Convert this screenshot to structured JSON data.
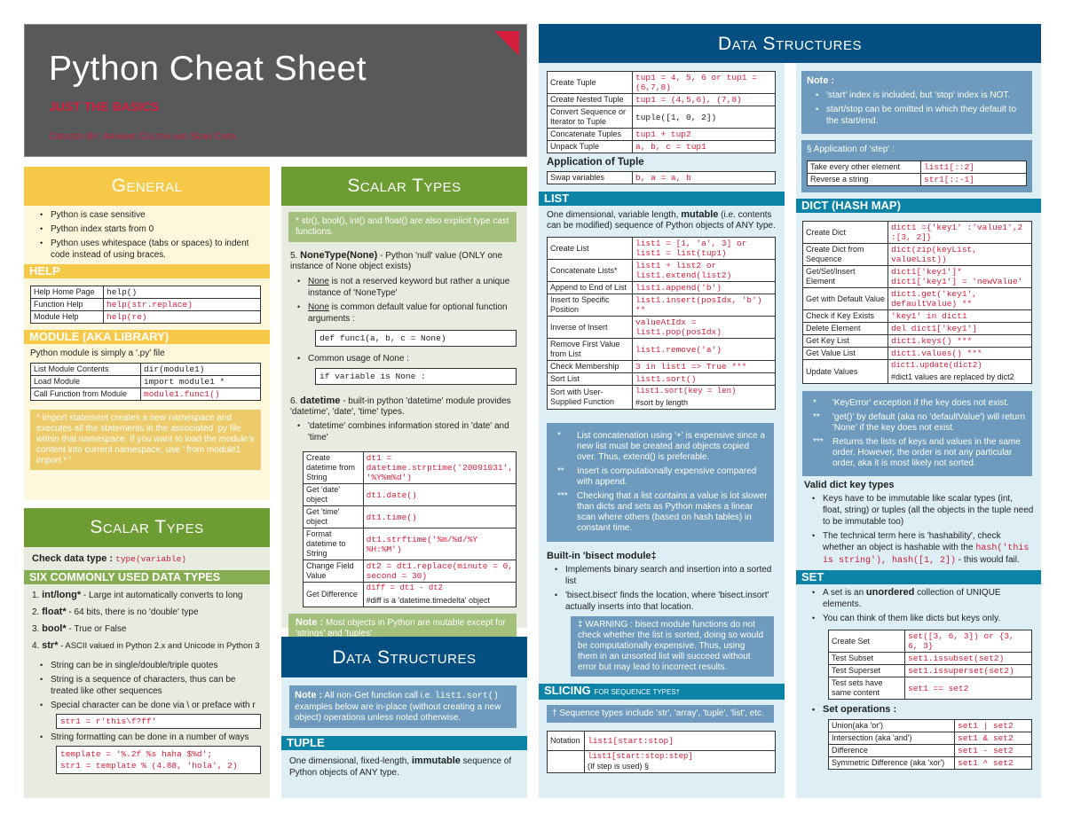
{
  "header": {
    "title": "Python Cheat Sheet",
    "subtitle": "JUST THE BASICS",
    "credit": "Created By: Arianne Colton and Sean Chen"
  },
  "colors": {
    "red": "#d31d3a",
    "yellow": "#f7c948",
    "green": "#6d9c33",
    "blue": "#044f82",
    "teal": "#0a83a6",
    "grey": "#58595b"
  },
  "general": {
    "title": "General",
    "bullets": [
      "Python is case sensitive",
      "Python index starts from 0",
      "Python uses whitespace (tabs or spaces) to indent code instead of using braces."
    ],
    "help_title": "HELP",
    "help_rows": [
      [
        "Help Home Page",
        "help()"
      ],
      [
        "Function Help",
        "help(str.replace)"
      ],
      [
        "Module Help",
        "help(re)"
      ]
    ],
    "module_title": "MODULE (AKA LIBRARY)",
    "module_desc": "Python module is simply a '.py' file",
    "module_rows": [
      [
        "List Module Contents",
        "dir(module1)"
      ],
      [
        "Load Module",
        "import module1 *"
      ],
      [
        "Call Function from Module",
        "module1.func1()"
      ]
    ],
    "module_note": "* import statement creates a new namespace and executes all the statements in the associated .py file within that namespace. If you want to load the module's content into current namespace, use ' from module1 import * '"
  },
  "scalar1": {
    "title": "Scalar Types",
    "check_label": "Check data type :",
    "check_code": "type(variable)",
    "six_title": "SIX COMMONLY USED DATA TYPES",
    "types": [
      {
        "n": "1.",
        "name": "int/long*",
        "desc": " - Large int automatically converts to long"
      },
      {
        "n": "2.",
        "name": "float*",
        "desc": " - 64 bits, there is no 'double' type"
      },
      {
        "n": "3.",
        "name": "bool*",
        "desc": " - True or False"
      },
      {
        "n": "4.",
        "name": "str*",
        "desc": " - ASCII valued in Python 2.x and Unicode in Python 3"
      }
    ],
    "str_bullets": [
      "String can be in single/double/triple quotes",
      "String is a sequence of characters, thus can be treated like other sequences",
      "Special character can be done via \\ or preface with r"
    ],
    "raw_code": "str1 = r'this\\f?ff'",
    "fmt_bullet": "String formatting can be done in a number of ways",
    "fmt_code1": "template = '%.2f %s haha $%d';",
    "fmt_code2": "str1 = template % (4.88, 'hola', 2)"
  },
  "scalar2": {
    "title": "Scalar Types",
    "cast_note": "* str(), bool(), int() and float() are also explicit type cast functions.",
    "none_num": "5.",
    "none_name": "NoneType(None)",
    "none_desc": " - Python 'null' value (ONLY one instance of None object exists)",
    "none_b1": " is not a reserved keyword but rather a unique instance of 'NoneType'",
    "none_b2": " is common default value for optional function arguments :",
    "none_word": "None",
    "none_code1": "def func1(a, b, c = None)",
    "none_b3": "Common usage of None :",
    "none_code2": "if variable is None :",
    "dt_num": "6.",
    "dt_name": "datetime",
    "dt_desc": " - built-in python 'datetime' module provides 'datetime', 'date', 'time' types.",
    "dt_bullet": "'datetime' combines information stored in 'date' and 'time'",
    "dt_rows": [
      [
        "Create datetime from String",
        "dt1 = datetime.strptime('20091031', '%Y%m%d')"
      ],
      [
        "Get 'date' object",
        "dt1.date()"
      ],
      [
        "Get 'time' object",
        "dt1.time()"
      ],
      [
        "Format datetime to String",
        "dt1.strftime('%m/%d/%Y %H:%M')"
      ],
      [
        "Change Field Value",
        "dt2 = dt1.replace(minute = 0, second = 30)"
      ],
      [
        "Get Difference",
        "diff = dt1 - dt2"
      ]
    ],
    "dt_diff_note": "#diff is a 'datetime.timedelta' object",
    "mut_label": "Note :",
    "mut_text": " Most objects in Python are mutable except for 'strings' and 'tuples'"
  },
  "ds1": {
    "title": "Data Structures",
    "note_label": "Note :",
    "note_text": " All non-Get function call i.e. ",
    "note_code": "list1.sort()",
    "note_text2": " examples below are in-place (without creating a new object) operations unless noted otherwise.",
    "tuple_title": "TUPLE",
    "tuple_desc1": "One dimensional, fixed-length, ",
    "tuple_bold": "immutable",
    "tuple_desc2": " sequence of Python objects of ANY type."
  },
  "ds2": {
    "title": "Data Structures",
    "tuple_rows": [
      [
        "Create Tuple",
        "tup1 = 4, 5, 6 or tup1 = (6,7,8)"
      ],
      [
        "Create Nested Tuple",
        "tup1 = (4,5,6), (7,8)"
      ],
      [
        "Convert Sequence or Iterator to Tuple",
        "tuple([1, 0, 2])"
      ],
      [
        "Concatenate Tuples",
        "tup1 + tup2"
      ],
      [
        "Unpack Tuple",
        "a, b, c = tup1"
      ]
    ],
    "app_title": "Application of Tuple",
    "app_rows": [
      [
        "Swap variables",
        "b, a = a, b"
      ]
    ],
    "list_title": "LIST",
    "list_desc1": "One dimensional, variable length, ",
    "list_bold": "mutable",
    "list_desc2": " (i.e. contents can be modified) sequence of Python objects of ANY type.",
    "list_rows": [
      [
        "Create List",
        "list1 = [1, 'a', 3] or list1 = list(tup1)"
      ],
      [
        "Concatenate Lists*",
        "list1 + list2 or list1.extend(list2)"
      ],
      [
        "Append to End of List",
        "list1.append('b')"
      ],
      [
        "Insert to Specific Position",
        "list1.insert(posIdx, 'b') **"
      ],
      [
        "Inverse of Insert",
        "valueAtIdx = list1.pop(posIdx)"
      ],
      [
        "Remove First Value from List",
        "list1.remove('a')"
      ],
      [
        "Check Membership",
        "3 in list1 => True ***"
      ],
      [
        "Sort List",
        "list1.sort()"
      ],
      [
        "Sort with User-Supplied Function",
        "list1.sort(key = len)"
      ]
    ],
    "sort_note": "#sort by length",
    "list_notes": [
      [
        "*",
        "List concatenation using '+' is expensive since a new list must be created and objects copied over. Thus, extend() is preferable."
      ],
      [
        "**",
        "Insert is computationally expensive compared with append."
      ],
      [
        "***",
        "Checking that a list contains a value is lot slower than dicts and sets as Python makes a linear scan where others (based on hash tables) in constant time."
      ]
    ],
    "bisect_title": "Built-in 'bisect module‡",
    "bisect_bullets": [
      "Implements binary search and insertion into a sorted list",
      "'bisect.bisect' finds the location, where 'bisect.insort' actually inserts into that location."
    ],
    "bisect_warn": "‡ WARNING : bisect module functions do not check whether the list is sorted, doing so would be computationally expensive. Thus, using them in an unsorted list will succeed without error but may lead to incorrect results.",
    "slice_title": "SLICING",
    "slice_sub": "FOR SEQUENCE TYPES†",
    "slice_note": "† Sequence types include 'str', 'array', 'tuple', 'list', etc.",
    "slice_rows": [
      [
        "Notation",
        "list1[start:stop]"
      ],
      [
        "",
        "list1[start:stop:step]"
      ]
    ],
    "slice_step_note": "(If step is used) §"
  },
  "ds3": {
    "note_label": "Note :",
    "note_bullets": [
      "'start' index is included, but 'stop' index is NOT.",
      "start/stop can be omitted in which they default to the start/end."
    ],
    "step_title": "§ Application of 'step' :",
    "step_rows": [
      [
        "Take every other element",
        "list1[::2]"
      ],
      [
        "Reverse a string",
        "str1[::-1]"
      ]
    ],
    "dict_title": "DICT (HASH MAP)",
    "dict_rows": [
      [
        "Create Dict",
        "dict1 ={'key1' :'value1',2 :[3, 2]}"
      ],
      [
        "Create Dict from Sequence",
        "dict(zip(keyList, valueList))"
      ],
      [
        "Get/Set/Insert Element",
        "dict1['key1']* dict1['key1'] = 'newValue'"
      ],
      [
        "Get with Default Value",
        "dict1.get('key1', defaultValue) **"
      ],
      [
        "Check if Key Exists",
        "'key1' in dict1"
      ],
      [
        "Delete Element",
        "del dict1['key1']"
      ],
      [
        "Get Key List",
        "dict1.keys() ***"
      ],
      [
        "Get Value List",
        "dict1.values() ***"
      ],
      [
        "Update Values",
        "dict1.update(dict2)"
      ]
    ],
    "update_note": "#dict1 values are replaced by dict2",
    "dict_notes": [
      [
        "*",
        "'KeyError' exception if the key does not exist."
      ],
      [
        "**",
        "'get()' by default (aka no 'defaultValue') will return 'None' if the key does not exist."
      ],
      [
        "***",
        "Returns the lists of keys and values in the same order. However, the order is not any particular order, aka it is most likely not sorted."
      ]
    ],
    "valid_title": "Valid dict key types",
    "valid_b1": "Keys have to be immutable like scalar types (int, float, string) or tuples (all the objects in the tuple need to be immutable too)",
    "valid_b2a": "The technical term here is 'hashability', check whether an object is hashable with the ",
    "valid_code": "hash('this is string'), hash([1, 2])",
    "valid_b2b": " - this would fail.",
    "set_title": "SET",
    "set_b1a": "A set is an ",
    "set_bold": "unordered",
    "set_b1b": " collection of UNIQUE elements.",
    "set_b2": "You can think of them like dicts but keys only.",
    "set_rows": [
      [
        "Create Set",
        "set([3, 6, 3]) or {3, 6, 3}"
      ],
      [
        "Test Subset",
        "set1.issubset(set2)"
      ],
      [
        "Test Superset",
        "set1.issuperset(set2)"
      ],
      [
        "Test sets have same content",
        "set1 == set2"
      ]
    ],
    "setops_title": "Set operations :",
    "setops_rows": [
      [
        "Union(aka 'or')",
        "set1 | set2"
      ],
      [
        "Intersection (aka 'and')",
        "set1 & set2"
      ],
      [
        "Difference",
        "set1 - set2"
      ],
      [
        "Symmetric Difference (aka 'xor')",
        "set1 ^ set2"
      ]
    ]
  }
}
